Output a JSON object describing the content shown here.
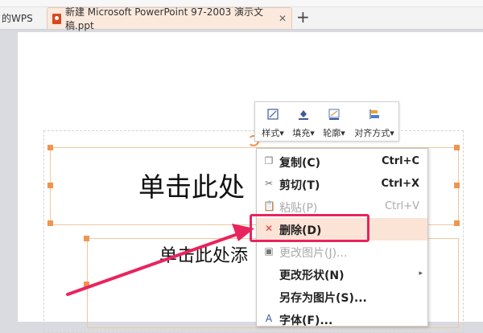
{
  "tabs": [
    {
      "label": "的WPS",
      "active": false
    },
    {
      "label": "新建 Microsoft PowerPoint 97-2003 演示文稿.ppt",
      "active": true,
      "close": "✕"
    }
  ],
  "newtab_label": "+",
  "slide": {
    "title_placeholder": "单击此处",
    "subtitle_placeholder": "单击此处添"
  },
  "minibar": [
    {
      "label": "样式",
      "icon": "style-icon"
    },
    {
      "label": "填充",
      "icon": "fill-icon"
    },
    {
      "label": "轮廓",
      "icon": "outline-icon"
    },
    {
      "label": "对齐方式",
      "icon": "align-icon"
    }
  ],
  "context_menu": [
    {
      "label": "复制(C)",
      "shortcut": "Ctrl+C",
      "icon": "copy-icon",
      "disabled": false
    },
    {
      "label": "剪切(T)",
      "shortcut": "Ctrl+X",
      "icon": "cut-icon",
      "disabled": false
    },
    {
      "label": "粘贴(P)",
      "shortcut": "Ctrl+V",
      "icon": "paste-icon",
      "disabled": true
    },
    {
      "label": "删除(D)",
      "shortcut": "",
      "icon": "delete-icon",
      "disabled": false,
      "highlighted": true
    },
    {
      "label": "更改图片(J)...",
      "shortcut": "",
      "icon": "change-picture-icon",
      "disabled": true
    },
    {
      "label": "更改形状(N)",
      "shortcut": "",
      "icon": "",
      "disabled": false,
      "submenu": true
    },
    {
      "label": "另存为图片(S)...",
      "shortcut": "",
      "icon": "",
      "disabled": false
    },
    {
      "label": "字体(F)...",
      "shortcut": "",
      "icon": "font-icon",
      "disabled": false
    }
  ],
  "colors": {
    "highlight_box": "#e8245f",
    "annotation_arrow": "#e8245f",
    "selection_handle": "#f0954f"
  }
}
